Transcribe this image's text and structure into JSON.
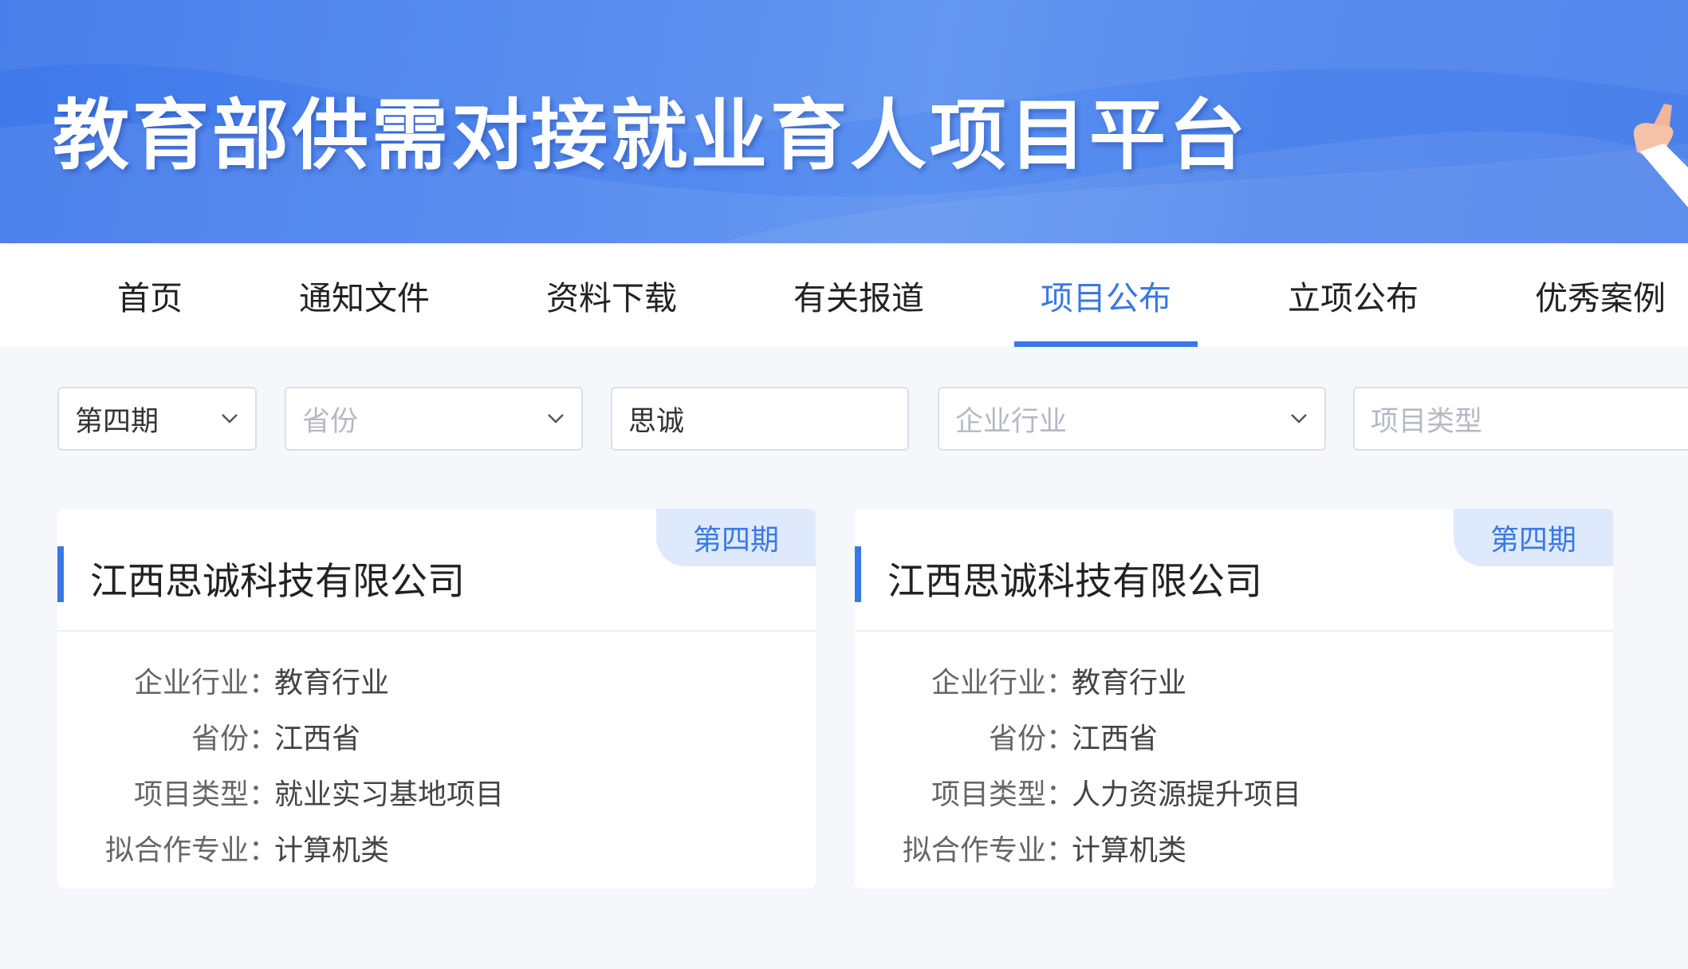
{
  "banner": {
    "title": "教育部供需对接就业育人项目平台"
  },
  "nav": {
    "items": [
      {
        "label": "首页"
      },
      {
        "label": "通知文件"
      },
      {
        "label": "资料下载"
      },
      {
        "label": "有关报道"
      },
      {
        "label": "项目公布",
        "active": true
      },
      {
        "label": "立项公布"
      },
      {
        "label": "优秀案例"
      }
    ]
  },
  "filters": {
    "period": {
      "value": "第四期",
      "icon": "chevron-down-icon"
    },
    "province": {
      "placeholder": "省份",
      "icon": "chevron-down-icon"
    },
    "keyword": {
      "value": "思诚"
    },
    "industry": {
      "placeholder": "企业行业",
      "icon": "chevron-down-icon"
    },
    "project_type": {
      "placeholder": "项目类型"
    }
  },
  "colors": {
    "accent": "#3a78e6",
    "badge_bg": "#deeafc",
    "page_bg": "#f5f7fb"
  },
  "cards": [
    {
      "badge": "第四期",
      "title": "江西思诚科技有限公司",
      "fields": [
        {
          "label": "企业行业",
          "value": "教育行业"
        },
        {
          "label": "省份",
          "value": "江西省"
        },
        {
          "label": "项目类型",
          "value": "就业实习基地项目"
        },
        {
          "label": "拟合作专业",
          "value": "计算机类"
        }
      ]
    },
    {
      "badge": "第四期",
      "title": "江西思诚科技有限公司",
      "fields": [
        {
          "label": "企业行业",
          "value": "教育行业"
        },
        {
          "label": "省份",
          "value": "江西省"
        },
        {
          "label": "项目类型",
          "value": "人力资源提升项目"
        },
        {
          "label": "拟合作专业",
          "value": "计算机类"
        }
      ]
    }
  ],
  "field_colon": "："
}
